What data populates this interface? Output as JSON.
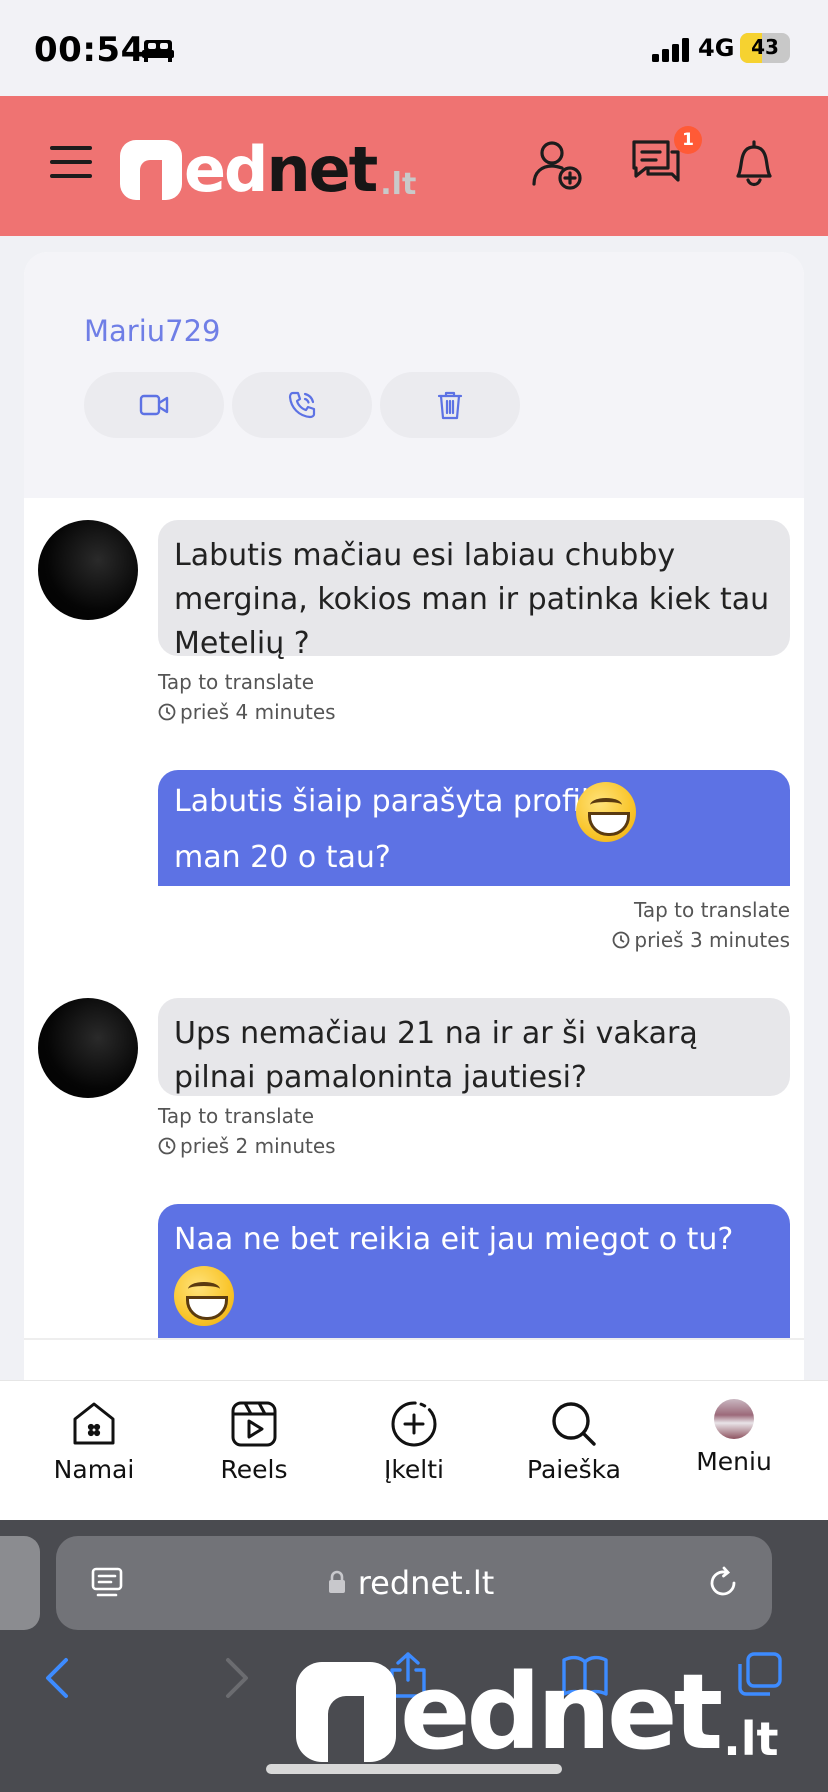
{
  "status_bar": {
    "time": "00:54",
    "network": "4G",
    "battery": "43",
    "battery_level": 0.43
  },
  "header": {
    "logo_prefix": "ed",
    "logo_main": "net",
    "logo_tld": ".lt",
    "messages_badge": "1"
  },
  "chat": {
    "username": "Mariu729",
    "actions": [
      "video-call",
      "voice-call",
      "delete"
    ],
    "messages": [
      {
        "direction": "in",
        "text": "Labutis mačiau esi labiau chubby mergina, kokios man ir patinka kiek tau Metelių ?",
        "translate": "Tap to translate",
        "time": "prieš 4 minutes"
      },
      {
        "direction": "out",
        "text": "Labutis šiaip parašyta profilyje",
        "text2": "man 20 o tau?",
        "translate": "Tap to translate",
        "time": "prieš 3 minutes"
      },
      {
        "direction": "in",
        "text": "Ups nemačiau 21 na ir ar ši vakarą pilnai pamaloninta jautiesi?",
        "translate": "Tap to translate",
        "time": "prieš 2 minutes"
      },
      {
        "direction": "out",
        "text": "Naa ne bet reikia eit jau miegot o tu?"
      }
    ]
  },
  "bottom_nav": {
    "items": [
      {
        "label": "Namai",
        "icon": "home-icon"
      },
      {
        "label": "Reels",
        "icon": "reels-icon"
      },
      {
        "label": "Įkelti",
        "icon": "upload-plus-icon"
      },
      {
        "label": "Paieška",
        "icon": "search-icon"
      },
      {
        "label": "Meniu",
        "icon": "avatar"
      }
    ]
  },
  "browser": {
    "url": "rednet.lt",
    "watermark_main": "ednet",
    "watermark_tld": ".lt"
  },
  "colors": {
    "header": "#ef7372",
    "accent": "#5d72e4",
    "incoming_bubble": "#e7e7ea"
  }
}
